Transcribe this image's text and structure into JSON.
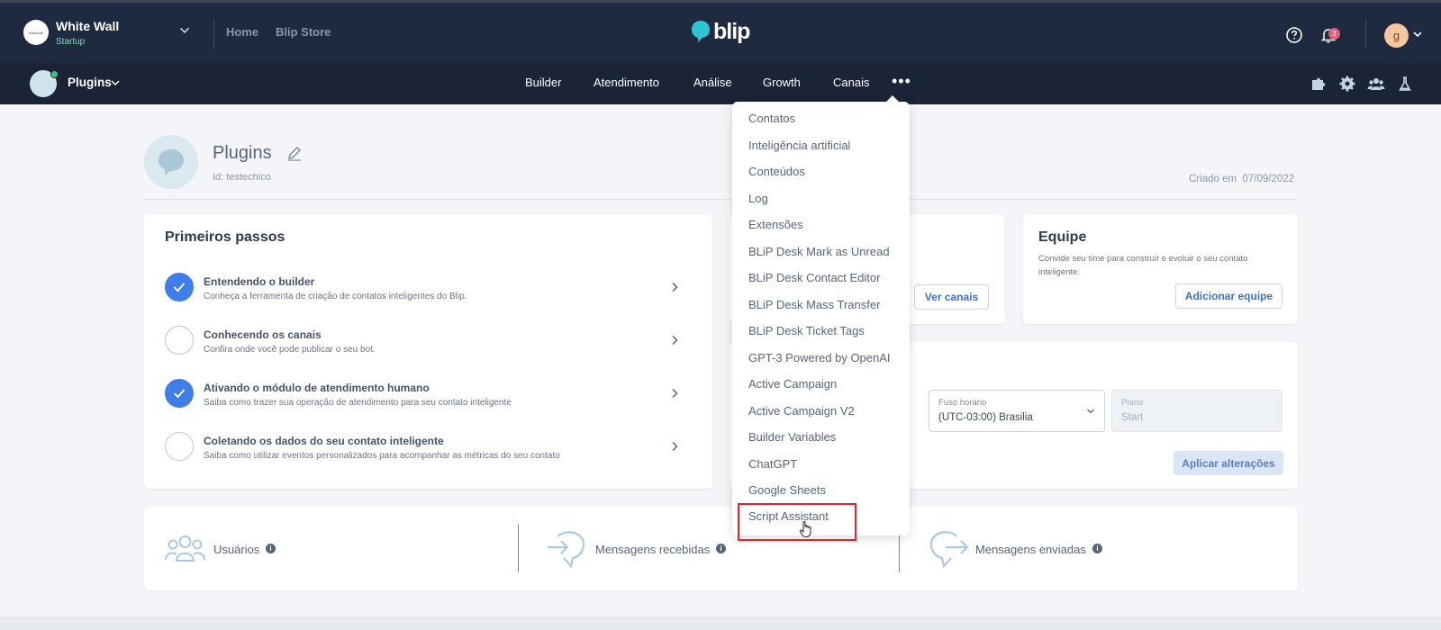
{
  "topbar": {
    "org_logo_text": "whitewall",
    "org_name": "White Wall",
    "org_plan": "Startup",
    "links": [
      "Home",
      "Blip Store"
    ],
    "brand": "blip",
    "notification_count": "3",
    "user_initial": "g",
    "icons": [
      "help-icon",
      "bell-icon",
      "chevron-down-icon"
    ]
  },
  "subbar": {
    "bot_name": "Plugins",
    "nav": [
      "Builder",
      "Atendimento",
      "Análise",
      "Growth",
      "Canais"
    ],
    "more": "•••",
    "icons": [
      "puzzle-icon",
      "gear-icon",
      "team-icon",
      "flask-icon"
    ]
  },
  "header": {
    "title": "Plugins",
    "id_label": "Id: testechico",
    "created_label": "Criado em",
    "created_date": "07/09/2022"
  },
  "first_steps": {
    "title": "Primeiros passos",
    "steps": [
      {
        "title": "Entendendo o builder",
        "desc": "Conheça a ferramenta de criação de contatos inteligentes do Blip.",
        "done": true
      },
      {
        "title": "Conhecendo os canais",
        "desc": "Confira onde você pode publicar o seu bot.",
        "done": false
      },
      {
        "title": "Ativando o módulo de atendimento humano",
        "desc": "Saiba como trazer sua operação de atendimento para seu contato inteligente",
        "done": true
      },
      {
        "title": "Coletando os dados do seu contato inteligente",
        "desc": "Saiba como utilizar eventos personalizados para acompanhar as métricas do seu contato",
        "done": false
      }
    ]
  },
  "channels_card": {
    "button": "Ver canais"
  },
  "team_card": {
    "title": "Equipe",
    "desc": "Convide seu time para construir e evoluir o seu contato inteligente.",
    "button": "Adicionar equipe"
  },
  "settings": {
    "timezone_label": "Fuso horário",
    "timezone_value": "(UTC-03:00) Brasilia",
    "plan_label": "Plano",
    "plan_value": "Start",
    "apply_button": "Aplicar alterações"
  },
  "stats": [
    {
      "label": "Usuários",
      "icon": "users-icon"
    },
    {
      "label": "Mensagens recebidas",
      "icon": "message-in-icon"
    },
    {
      "label": "Mensagens enviadas",
      "icon": "message-out-icon"
    }
  ],
  "dropdown": {
    "items": [
      "Contatos",
      "Inteligência artificial",
      "Conteúdos",
      "Log",
      "Extensões",
      "BLiP Desk Mark as Unread",
      "BLiP Desk Contact Editor",
      "BLiP Desk Mass Transfer",
      "BLiP Desk Ticket Tags",
      "GPT-3 Powered by OpenAI",
      "Active Campaign",
      "Active Campaign V2",
      "Builder Variables",
      "ChatGPT",
      "Google Sheets",
      "Script Assistant"
    ],
    "highlighted": "Script Assistant",
    "highlight_color": "#e0242b"
  },
  "colors": {
    "topbar": "#1f2940",
    "subbar": "#1b2436",
    "accent": "#3f7de8",
    "brand": "#2cc3d5"
  }
}
